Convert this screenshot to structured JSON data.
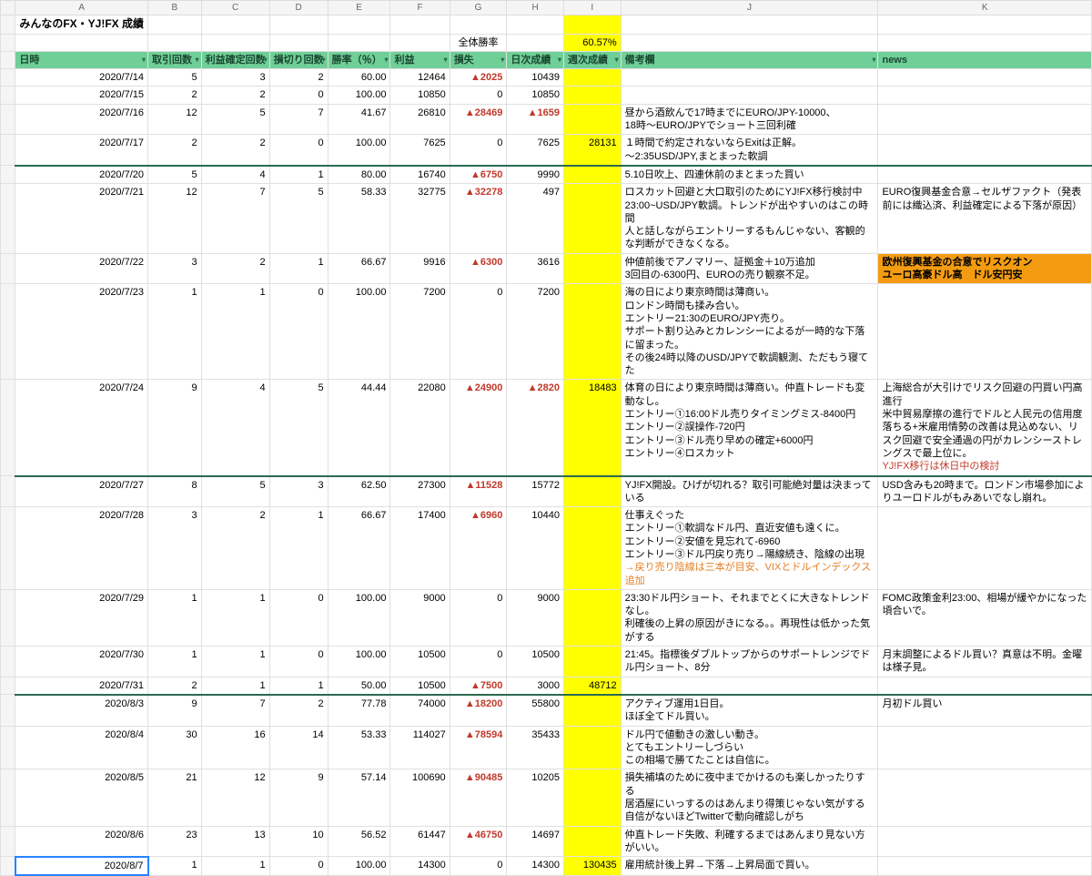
{
  "title": "みんなのFX・YJ!FX 成績",
  "summary": {
    "label": "全体勝率",
    "value": "60.57%"
  },
  "columns_letters": [
    "A",
    "B",
    "C",
    "D",
    "E",
    "F",
    "G",
    "H",
    "I",
    "J",
    "K"
  ],
  "headers": [
    "日時",
    "取引回数",
    "利益確定回数",
    "損切り回数",
    "勝率（％）",
    "利益",
    "損失",
    "日次成績",
    "週次成績",
    "備考欄",
    "news"
  ],
  "rows": [
    {
      "date": "2020/7/14",
      "trades": "5",
      "wins": "3",
      "losses": "2",
      "rate": "60.00",
      "profit": "12464",
      "loss": "▲2025",
      "daily": "10439",
      "weekly": "",
      "memo": "",
      "news": ""
    },
    {
      "date": "2020/7/15",
      "trades": "2",
      "wins": "2",
      "losses": "0",
      "rate": "100.00",
      "profit": "10850",
      "loss": "0",
      "daily": "10850",
      "weekly": "",
      "memo": "",
      "news": ""
    },
    {
      "date": "2020/7/16",
      "trades": "12",
      "wins": "5",
      "losses": "7",
      "rate": "41.67",
      "profit": "26810",
      "loss": "▲28469",
      "daily": "▲1659",
      "weekly": "",
      "memo": "昼から酒飲んで17時までにEURO/JPY-10000、\n18時〜EURO/JPYでショート三回利確",
      "news": ""
    },
    {
      "date": "2020/7/17",
      "trades": "2",
      "wins": "2",
      "losses": "0",
      "rate": "100.00",
      "profit": "7625",
      "loss": "0",
      "daily": "7625",
      "weekly": "28131",
      "memo": "１時間で約定されないならExitは正解。\n〜2:35USD/JPY,まとまった軟調",
      "news": "",
      "thick": true
    },
    {
      "date": "2020/7/20",
      "trades": "5",
      "wins": "4",
      "losses": "1",
      "rate": "80.00",
      "profit": "16740",
      "loss": "▲6750",
      "daily": "9990",
      "weekly": "",
      "memo": "5.10日吹上、四連休前のまとまった買い",
      "news": ""
    },
    {
      "date": "2020/7/21",
      "trades": "12",
      "wins": "7",
      "losses": "5",
      "rate": "58.33",
      "profit": "32775",
      "loss": "▲32278",
      "daily": "497",
      "weekly": "",
      "memo": "ロスカット回避と大口取引のためにYJ!FX移行検討中\n23:00~USD/JPY軟調。トレンドが出やすいのはこの時間\n人と話しながらエントリーするもんじゃない、客観的な判断ができなくなる。",
      "news": "EURO復興基金合意→セルザファクト（発表前には織込済、利益確定による下落が原因）"
    },
    {
      "date": "2020/7/22",
      "trades": "3",
      "wins": "2",
      "losses": "1",
      "rate": "66.67",
      "profit": "9916",
      "loss": "▲6300",
      "daily": "3616",
      "weekly": "",
      "memo": "仲値前後でアノマリー、証拠金＋10万追加\n3回目の-6300円、EUROの売り観察不足。",
      "news": "欧州復興基金の合意でリスクオン\nユーロ高豪ドル高　ドル安円安",
      "news_orange": true
    },
    {
      "date": "2020/7/23",
      "trades": "1",
      "wins": "1",
      "losses": "0",
      "rate": "100.00",
      "profit": "7200",
      "loss": "0",
      "daily": "7200",
      "weekly": "",
      "memo": "海の日により東京時間は薄商い。\nロンドン時間も揉み合い。\nエントリー21:30のEURO/JPY売り。\nサポート割り込みとカレンシーによるが一時的な下落に留まった。\nその後24時以降のUSD/JPYで軟調観測、ただもう寝てた",
      "news": ""
    },
    {
      "date": "2020/7/24",
      "trades": "9",
      "wins": "4",
      "losses": "5",
      "rate": "44.44",
      "profit": "22080",
      "loss": "▲24900",
      "daily": "▲2820",
      "weekly": "18483",
      "memo": "体育の日により東京時間は薄商い。仲直トレードも変動なし。\nエントリー①16:00ドル売りタイミングミス-8400円\nエントリー②誤操作-720円\nエントリー③ドル売り早めの確定+6000円\nエントリー④ロスカット",
      "news": "上海総合が大引けでリスク回避の円買い円高進行\n米中貿易摩擦の進行でドルと人民元の信用度落ちる+米雇用情勢の改善は見込めない、リスク回避で安全通過の円がカレンシーストレングスで最上位に。\nYJ!FX移行は休日中の検討",
      "news_red_last": "YJ!FX移行は休日中の検討",
      "thick": true
    },
    {
      "date": "2020/7/27",
      "trades": "8",
      "wins": "5",
      "losses": "3",
      "rate": "62.50",
      "profit": "27300",
      "loss": "▲11528",
      "daily": "15772",
      "weekly": "",
      "memo": "YJ!FX開設。ひげが切れる？取引可能絶対量は決まっている",
      "news": "USD含みも20時まで。ロンドン市場参加によりユーロドルがもみあいでなし崩れ。"
    },
    {
      "date": "2020/7/28",
      "trades": "3",
      "wins": "2",
      "losses": "1",
      "rate": "66.67",
      "profit": "17400",
      "loss": "▲6960",
      "daily": "10440",
      "weekly": "",
      "memo": "仕事えぐった\nエントリー①軟調なドル円、直近安値も遠くに。\nエントリー②安値を見忘れて-6960\nエントリー③ドル円戻り売り→陽線続き、陰線の出現\n→戻り売り陰線は三本が目安、VIXとドルインデックス追加",
      "memo_orange_last": "→戻り売り陰線は三本が目安、VIXとドルインデックス追加",
      "news": ""
    },
    {
      "date": "2020/7/29",
      "trades": "1",
      "wins": "1",
      "losses": "0",
      "rate": "100.00",
      "profit": "9000",
      "loss": "0",
      "daily": "9000",
      "weekly": "",
      "memo": "23:30ドル円ショート、それまでとくに大きなトレンドなし。\n利確後の上昇の原因がきになる。。再現性は低かった気がする",
      "news": "FOMC政策金利23:00、相場が緩やかになった頃合いで。"
    },
    {
      "date": "2020/7/30",
      "trades": "1",
      "wins": "1",
      "losses": "0",
      "rate": "100.00",
      "profit": "10500",
      "loss": "0",
      "daily": "10500",
      "weekly": "",
      "memo": "21:45。指標後ダブルトップからのサポートレンジでドル円ショート、8分",
      "news": "月末調整によるドル買い？真意は不明。金曜は様子見。"
    },
    {
      "date": "2020/7/31",
      "trades": "2",
      "wins": "1",
      "losses": "1",
      "rate": "50.00",
      "profit": "10500",
      "loss": "▲7500",
      "daily": "3000",
      "weekly": "48712",
      "memo": "",
      "news": "",
      "thick": true
    },
    {
      "date": "2020/8/3",
      "trades": "9",
      "wins": "7",
      "losses": "2",
      "rate": "77.78",
      "profit": "74000",
      "loss": "▲18200",
      "daily": "55800",
      "weekly": "",
      "memo": "アクティブ運用1日目。\nほぼ全てドル買い。",
      "news": "月初ドル買い"
    },
    {
      "date": "2020/8/4",
      "trades": "30",
      "wins": "16",
      "losses": "14",
      "rate": "53.33",
      "profit": "114027",
      "loss": "▲78594",
      "daily": "35433",
      "weekly": "",
      "memo": "ドル円で値動きの激しい動き。\nとてもエントリーしづらい\nこの相場で勝てたことは自信に。",
      "news": ""
    },
    {
      "date": "2020/8/5",
      "trades": "21",
      "wins": "12",
      "losses": "9",
      "rate": "57.14",
      "profit": "100690",
      "loss": "▲90485",
      "daily": "10205",
      "weekly": "",
      "memo": "損失補填のために夜中までかけるのも楽しかったりする\n居酒屋にいっするのはあんまり得策じゃない気がする\n自信がないほどTwitterで動向確認しがち",
      "news": ""
    },
    {
      "date": "2020/8/6",
      "trades": "23",
      "wins": "13",
      "losses": "10",
      "rate": "56.52",
      "profit": "61447",
      "loss": "▲46750",
      "daily": "14697",
      "weekly": "",
      "memo": "仲直トレード失敗、利確するまではあんまり見ない方がいい。",
      "news": ""
    },
    {
      "date": "2020/8/7",
      "trades": "1",
      "wins": "1",
      "losses": "0",
      "rate": "100.00",
      "profit": "14300",
      "loss": "0",
      "daily": "14300",
      "weekly": "130435",
      "memo": "雇用統計後上昇→下落→上昇局面で買い。",
      "news": "",
      "selected": true
    }
  ]
}
